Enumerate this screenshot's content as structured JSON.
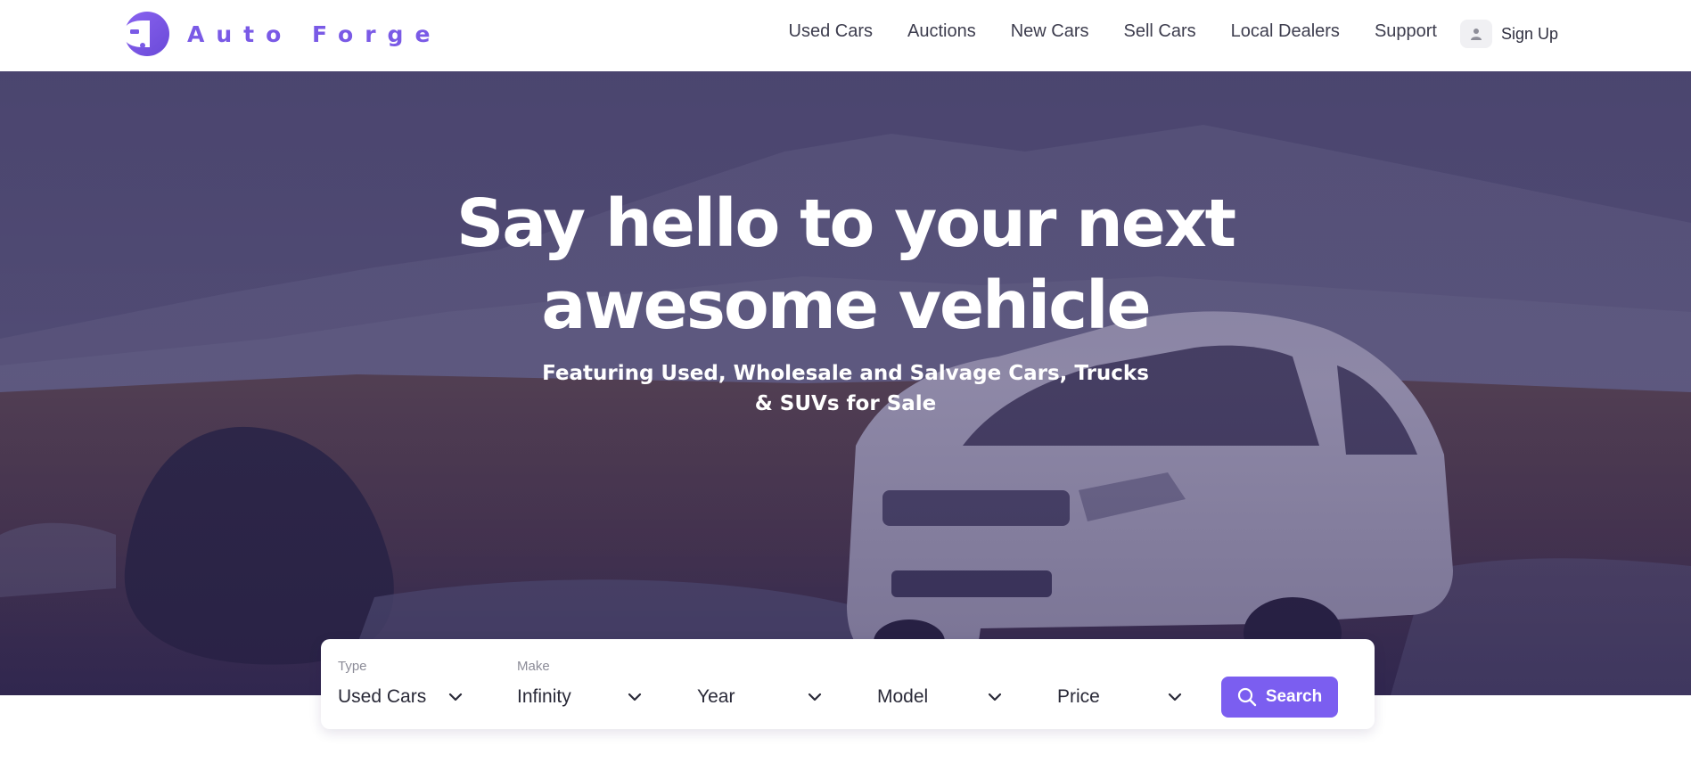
{
  "brand": {
    "name": "Auto Forge",
    "accent": "#7b5ef0"
  },
  "nav": {
    "items": [
      {
        "label": "Used Cars"
      },
      {
        "label": "Auctions"
      },
      {
        "label": "New Cars"
      },
      {
        "label": "Sell Cars"
      },
      {
        "label": "Local Dealers"
      },
      {
        "label": "Support"
      }
    ],
    "signup_label": "Sign Up",
    "signup_icon": "user-icon"
  },
  "hero": {
    "title_line1": "Say hello to your next",
    "title_line2": "awesome vehicle",
    "subtitle_line1": "Featuring Used, Wholesale and Salvage Cars, Trucks",
    "subtitle_line2": "& SUVs for Sale"
  },
  "search": {
    "fields": [
      {
        "label": "Type",
        "value": "Used Cars",
        "icon": "chevron-down-icon"
      },
      {
        "label": "Make",
        "value": "Infinity",
        "icon": "chevron-down-icon"
      },
      {
        "label": "",
        "value": "Year",
        "icon": "chevron-down-icon"
      },
      {
        "label": "",
        "value": "Model",
        "icon": "chevron-down-icon"
      },
      {
        "label": "",
        "value": "Price",
        "icon": "chevron-down-icon"
      }
    ],
    "button_label": "Search",
    "button_icon": "search-icon"
  }
}
